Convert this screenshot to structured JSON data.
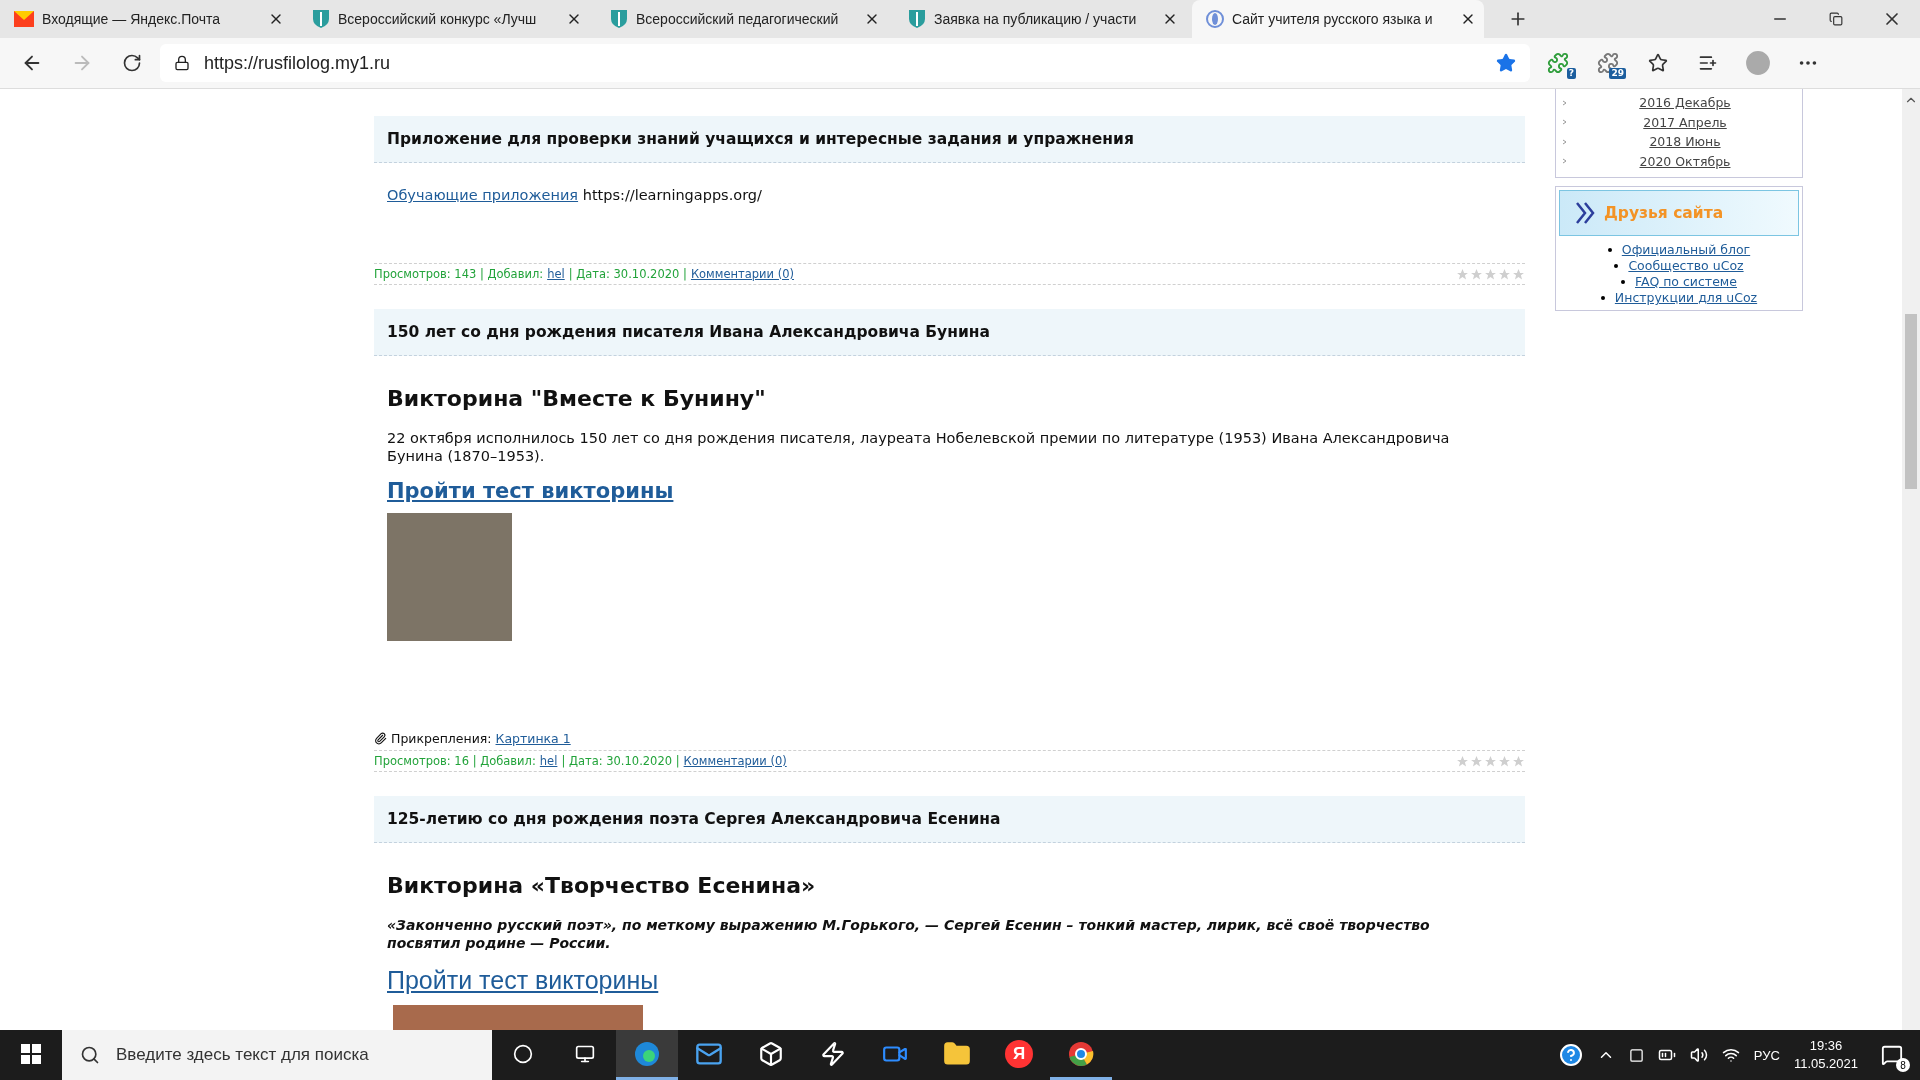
{
  "browser": {
    "tabs": [
      {
        "title": "Входящие — Яндекс.Почта",
        "kind": "mail",
        "selected": false
      },
      {
        "title": "Всероссийский конкурс «Лучш",
        "kind": "shield",
        "selected": false
      },
      {
        "title": "Всероссийский педагогический",
        "kind": "shield",
        "selected": false
      },
      {
        "title": "Заявка на публикацию / участи",
        "kind": "shield",
        "selected": false
      },
      {
        "title": "Сайт учителя русского языка и",
        "kind": "site",
        "selected": true
      }
    ],
    "address": "https://rusfilolog.my1.ru",
    "favorite": true,
    "extension_badges": [
      "?",
      "29"
    ]
  },
  "posts": [
    {
      "heading": "Приложение для проверки знаний учащихся и интересные задания и упражнения",
      "body_link": "Обучающие приложения",
      "body_text": "https://learningapps.org/",
      "meta": [
        {
          "text": "Просмотров: 143 | Добавил:",
          "link": false
        },
        {
          "text": "hel",
          "link": true
        },
        {
          "text": "| Дата: 30.10.2020 |",
          "link": false
        },
        {
          "text": "Комментарии (0)",
          "link": true
        }
      ],
      "stars": 0
    },
    {
      "heading": "150 лет со дня рождения писателя Ивана Александровича Бунина",
      "title": "Викторина \"Вместе к Бунину\"",
      "paragraph": "22 октября исполнилось 150 лет со дня рождения писателя, лауреата Нобелевской премии по литературе (1953) Ивана Александровича Бунина (1870–1953).",
      "emphasis": false,
      "quiz_link": "Пройти тест викторины",
      "quiz_bold": true,
      "photo": {
        "cropped": false
      },
      "attachments_label": "Прикрепления:",
      "attachment": "Картинка 1",
      "meta": [
        {
          "text": "Просмотров: 16 | Добавил:",
          "link": false
        },
        {
          "text": "hel",
          "link": true
        },
        {
          "text": "| Дата: 30.10.2020 |",
          "link": false
        },
        {
          "text": "Комментарии (0)",
          "link": true
        }
      ],
      "stars": 0
    },
    {
      "heading": "125-летию со дня рождения поэта Сергея Александровича Есенина",
      "title": "Викторина «Творчество Есенина»",
      "paragraph": "«Законченно русский поэт», по меткому выражению М.Горького, — Сергей Есенин – тонкий мастер, лирик, всё своё творчество посвятил родине — России.",
      "emphasis": true,
      "quiz_link": "Пройти тест викторины",
      "quiz_bold": false,
      "photo": {
        "cropped": true
      }
    }
  ],
  "sidebar": {
    "archive": [
      "2016 Декабрь",
      "2017 Апрель",
      "2018 Июнь",
      "2020 Октябрь"
    ],
    "friends_title": "Друзья сайта",
    "friends": [
      "Официальный блог",
      "Сообщество uCoz",
      "FAQ по системе",
      "Инструкции для uCoz"
    ]
  },
  "taskbar": {
    "search_placeholder": "Введите здесь текст для поиска",
    "apps": [
      {
        "kind": "edge",
        "running": true,
        "selected": true
      },
      {
        "kind": "mail",
        "running": false,
        "selected": false
      },
      {
        "kind": "dropbox",
        "running": false,
        "selected": false
      },
      {
        "kind": "bolt",
        "running": false,
        "selected": false
      },
      {
        "kind": "zoom",
        "running": false,
        "selected": false
      },
      {
        "kind": "folder",
        "running": false,
        "selected": false
      },
      {
        "kind": "yandex",
        "label": "Я",
        "running": false,
        "selected": false
      },
      {
        "kind": "chrome",
        "running": true,
        "selected": false
      }
    ],
    "language": "РУС",
    "time": "19:36",
    "date": "11.05.2021",
    "notifications": "8"
  }
}
